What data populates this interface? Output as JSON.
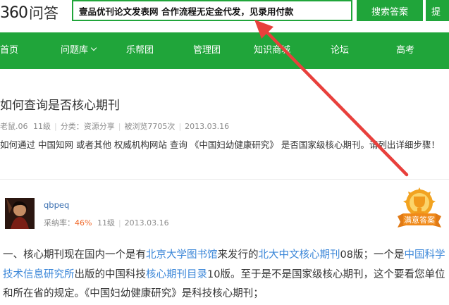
{
  "header": {
    "logo_number": "360",
    "logo_text": "问答",
    "search_value": "壹品优刊论文发表网   合作流程无定金代发，见录用付款",
    "search_button": "搜索答案",
    "ask_button": "提"
  },
  "nav": [
    {
      "label": "首页"
    },
    {
      "label": "问题库",
      "has_dropdown": true
    },
    {
      "label": "乐帮团"
    },
    {
      "label": "管理团"
    },
    {
      "label": "知识商城"
    },
    {
      "label": "论坛"
    },
    {
      "label": "高考"
    }
  ],
  "question": {
    "title": "如何查询是否核心期刊",
    "asker": "老鼠.06",
    "asker_level": "11级",
    "category": "分类：资源分享",
    "views": "被浏览7705次",
    "date": "2013.03.16",
    "description": "如何通过 中国知网 或者其他 权威机构网站 查询 《中国妇幼健康研究》 是否国家级核心期刊。请列出详细步骤！"
  },
  "answer": {
    "user": "qbpeq",
    "rate_label": "采纳率：",
    "rate_value": "46%",
    "level": "11级",
    "date": "2013.03.16",
    "badge_text": "满意答案",
    "segments": [
      {
        "text": "一、核心期刊现在国内一个是有",
        "link": false
      },
      {
        "text": "北京大学图书馆",
        "link": true
      },
      {
        "text": "来发行的",
        "link": false
      },
      {
        "text": "北大中文核心期刊",
        "link": true
      },
      {
        "text": "08版；一个是",
        "link": false
      },
      {
        "text": "中国科学技术信息研究所",
        "link": true
      },
      {
        "text": "出版的中国科技",
        "link": false
      },
      {
        "text": "核心期刊目录",
        "link": true
      },
      {
        "text": "10版。至于是不是国家级核心期刊，这个要看您单位和所在省的规定。《中国妇幼健康研究》是科技核心期刊；",
        "link": false
      }
    ]
  },
  "colors": {
    "brand_green": "#20a53a",
    "link_blue": "#3a86d8",
    "rate_orange": "#f06a2b",
    "arrow_red": "#e8403c"
  },
  "icons": [
    "chevron-down-icon",
    "red-arrow-annotation",
    "satisfied-answer-trophy-icon",
    "user-avatar"
  ]
}
